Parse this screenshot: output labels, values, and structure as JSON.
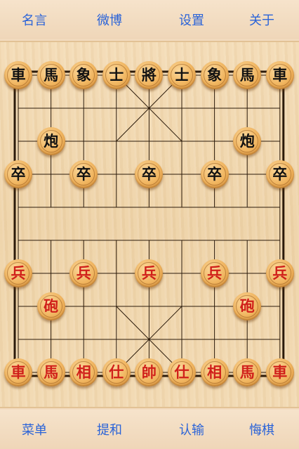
{
  "top_menu": [
    "名言",
    "微博",
    "设置",
    "关于"
  ],
  "bottom_menu": [
    "菜单",
    "提和",
    "认输",
    "悔棋"
  ],
  "colors": {
    "menu_text": "#2a63d8",
    "red_piece_text": "#d0201a",
    "black_piece_text": "#111111",
    "grid_line": "#2b1a0a"
  },
  "pieces": [
    {
      "label": "車",
      "side": "black",
      "file": 0,
      "rank": 0
    },
    {
      "label": "馬",
      "side": "black",
      "file": 1,
      "rank": 0
    },
    {
      "label": "象",
      "side": "black",
      "file": 2,
      "rank": 0
    },
    {
      "label": "士",
      "side": "black",
      "file": 3,
      "rank": 0
    },
    {
      "label": "將",
      "side": "black",
      "file": 4,
      "rank": 0
    },
    {
      "label": "士",
      "side": "black",
      "file": 5,
      "rank": 0
    },
    {
      "label": "象",
      "side": "black",
      "file": 6,
      "rank": 0
    },
    {
      "label": "馬",
      "side": "black",
      "file": 7,
      "rank": 0
    },
    {
      "label": "車",
      "side": "black",
      "file": 8,
      "rank": 0
    },
    {
      "label": "炮",
      "side": "black",
      "file": 1,
      "rank": 2
    },
    {
      "label": "炮",
      "side": "black",
      "file": 7,
      "rank": 2
    },
    {
      "label": "卒",
      "side": "black",
      "file": 0,
      "rank": 3
    },
    {
      "label": "卒",
      "side": "black",
      "file": 2,
      "rank": 3
    },
    {
      "label": "卒",
      "side": "black",
      "file": 4,
      "rank": 3
    },
    {
      "label": "卒",
      "side": "black",
      "file": 6,
      "rank": 3
    },
    {
      "label": "卒",
      "side": "black",
      "file": 8,
      "rank": 3
    },
    {
      "label": "兵",
      "side": "red",
      "file": 0,
      "rank": 6
    },
    {
      "label": "兵",
      "side": "red",
      "file": 2,
      "rank": 6
    },
    {
      "label": "兵",
      "side": "red",
      "file": 4,
      "rank": 6
    },
    {
      "label": "兵",
      "side": "red",
      "file": 6,
      "rank": 6
    },
    {
      "label": "兵",
      "side": "red",
      "file": 8,
      "rank": 6
    },
    {
      "label": "砲",
      "side": "red",
      "file": 1,
      "rank": 7
    },
    {
      "label": "砲",
      "side": "red",
      "file": 7,
      "rank": 7
    },
    {
      "label": "車",
      "side": "red",
      "file": 0,
      "rank": 9
    },
    {
      "label": "馬",
      "side": "red",
      "file": 1,
      "rank": 9
    },
    {
      "label": "相",
      "side": "red",
      "file": 2,
      "rank": 9
    },
    {
      "label": "仕",
      "side": "red",
      "file": 3,
      "rank": 9
    },
    {
      "label": "帥",
      "side": "red",
      "file": 4,
      "rank": 9
    },
    {
      "label": "仕",
      "side": "red",
      "file": 5,
      "rank": 9
    },
    {
      "label": "相",
      "side": "red",
      "file": 6,
      "rank": 9
    },
    {
      "label": "馬",
      "side": "red",
      "file": 7,
      "rank": 9
    },
    {
      "label": "車",
      "side": "red",
      "file": 8,
      "rank": 9
    }
  ]
}
